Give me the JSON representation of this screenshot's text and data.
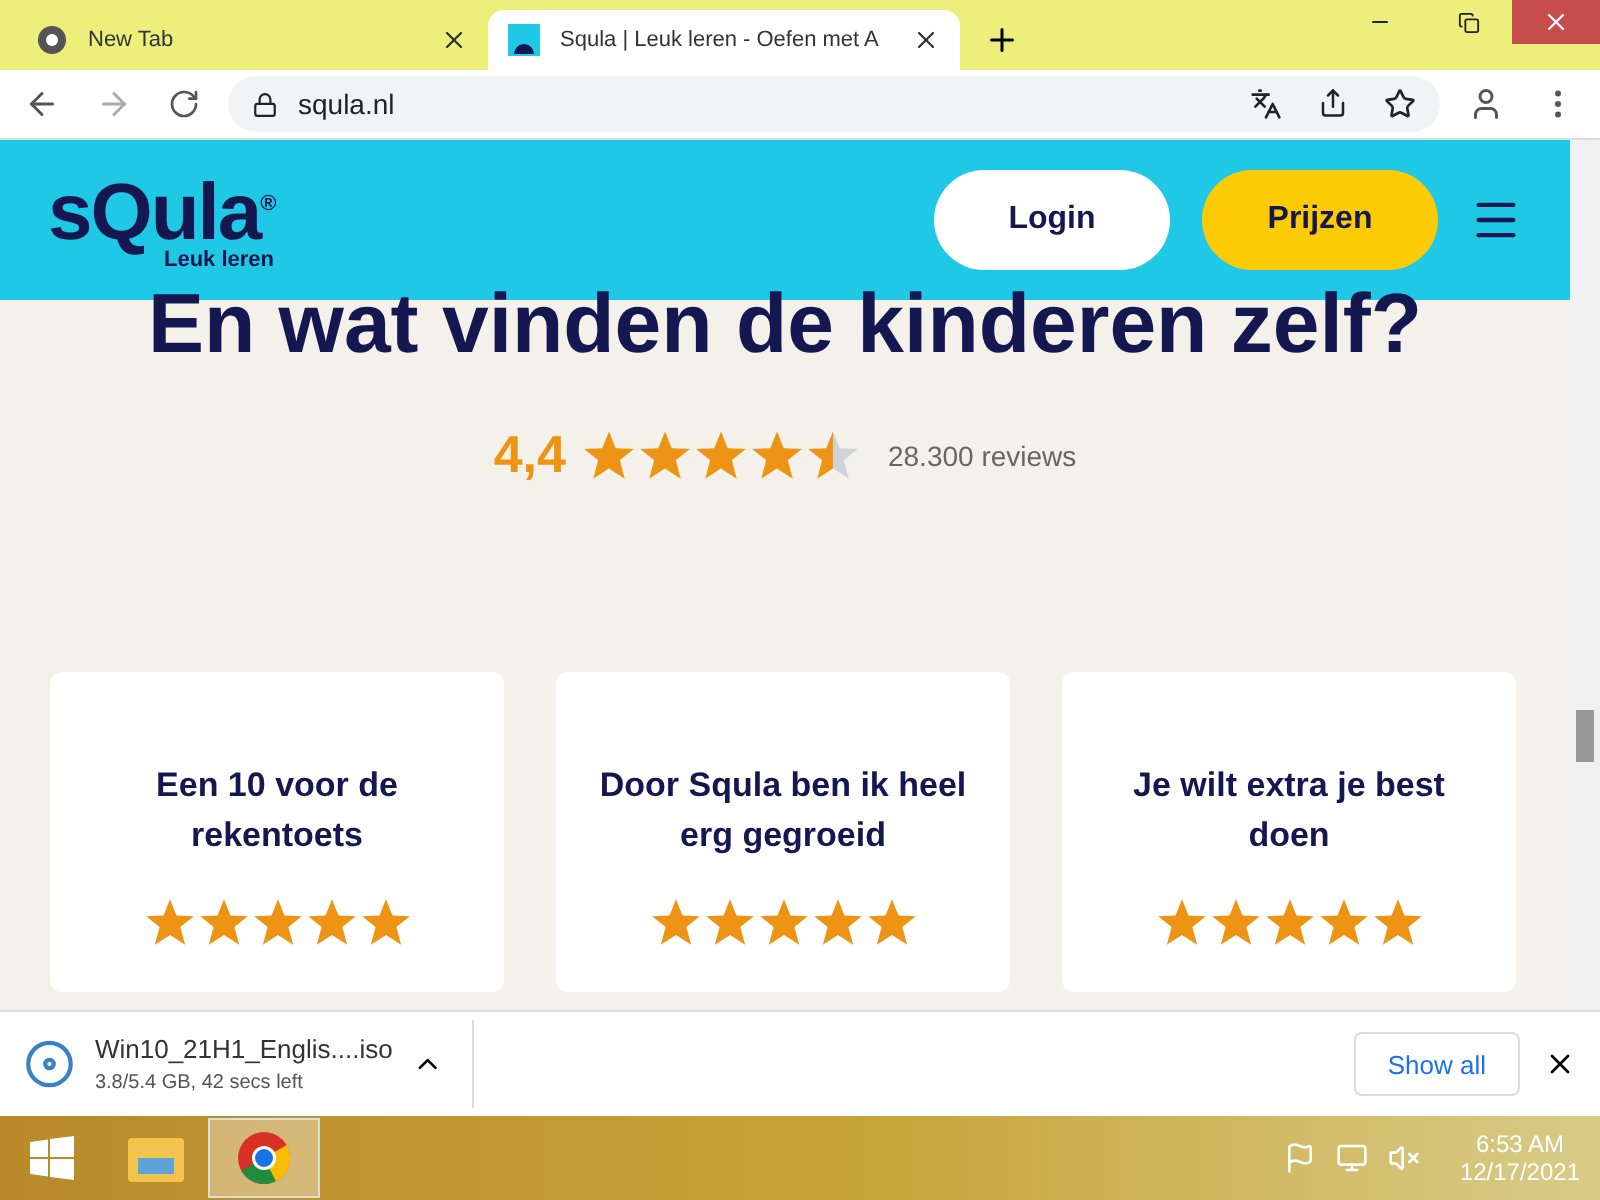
{
  "tabs": [
    {
      "title": "New Tab",
      "selected": false
    },
    {
      "title": "Squla | Leuk leren - Oefen met A",
      "selected": true
    }
  ],
  "address": "squla.nl",
  "header": {
    "logo": "sQula",
    "logo_mark": "®",
    "tagline": "Leuk leren",
    "buttons": [
      {
        "label": "Login",
        "kind": "light"
      },
      {
        "label": "Prijzen",
        "kind": "accent"
      }
    ]
  },
  "heading": "En wat vinden de kinderen zelf?",
  "rating": {
    "score": "4,4",
    "stars": 4.5,
    "count": "28.300 reviews"
  },
  "cards": [
    {
      "quote": "Een 10 voor de rekentoets",
      "stars": 5
    },
    {
      "quote": "Door Squla ben ik heel erg gegroeid",
      "stars": 5
    },
    {
      "quote": "Je wilt extra je best doen",
      "stars": 5
    }
  ],
  "download": {
    "file": "Win10_21H1_Englis....iso",
    "status": "3.8/5.4 GB, 42 secs left",
    "button": "Show all"
  },
  "taskbar": {
    "time": "6:53 AM",
    "date": "12/17/2021"
  }
}
